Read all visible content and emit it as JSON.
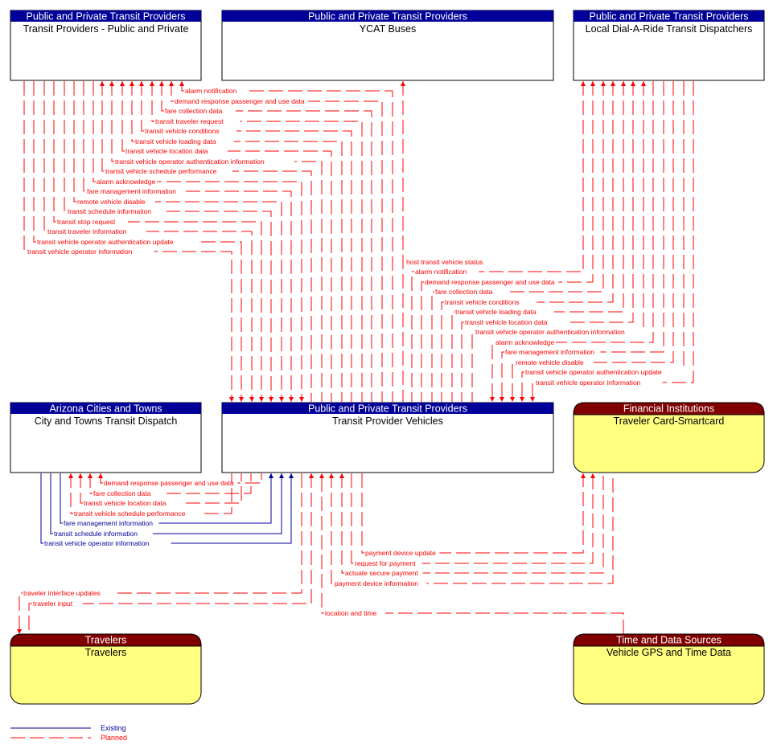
{
  "colors": {
    "planned": "#ff0000",
    "existing": "#000099",
    "node_header_blue": "#000099",
    "node_header_maroon": "#800000",
    "node_fill_yellow": "#ffff80"
  },
  "nodes": {
    "tp": {
      "header": "Public and Private Transit Providers",
      "name": "Transit Providers - Public and Private"
    },
    "ycat": {
      "header": "Public and Private Transit Providers",
      "name": "YCAT Buses"
    },
    "dar": {
      "header": "Public and Private Transit Providers",
      "name": "Local Dial-A-Ride Transit Dispatchers"
    },
    "city": {
      "header": "Arizona Cities and Towns",
      "name": "City and Towns Transit Dispatch"
    },
    "veh": {
      "header": "Public and Private Transit Providers",
      "name": "Transit Provider Vehicles"
    },
    "fin": {
      "header": "Financial Institutions",
      "name": "Traveler Card-Smartcard"
    },
    "trav": {
      "header": "Travelers",
      "name": "Travelers"
    },
    "gps": {
      "header": "Time and Data Sources",
      "name": "Vehicle GPS and Time Data"
    }
  },
  "flows_tp": [
    {
      "label": "alarm notification",
      "dir": "to_tp"
    },
    {
      "label": "demand response passenger and use data",
      "dir": "to_tp"
    },
    {
      "label": "fare collection data",
      "dir": "to_tp"
    },
    {
      "label": "transit traveler request",
      "dir": "to_tp"
    },
    {
      "label": "transit vehicle conditions",
      "dir": "to_tp"
    },
    {
      "label": "transit vehicle loading data",
      "dir": "to_tp"
    },
    {
      "label": "transit vehicle location data",
      "dir": "to_tp"
    },
    {
      "label": "transit vehicle operator authentication information",
      "dir": "to_tp"
    },
    {
      "label": "transit vehicle schedule performance",
      "dir": "to_tp"
    },
    {
      "label": "alarm acknowledge",
      "dir": "to_veh"
    },
    {
      "label": "fare management information",
      "dir": "to_veh"
    },
    {
      "label": "remote vehicle disable",
      "dir": "to_veh"
    },
    {
      "label": "transit schedule information",
      "dir": "to_veh"
    },
    {
      "label": "transit stop request",
      "dir": "to_veh"
    },
    {
      "label": "transit traveler information",
      "dir": "to_veh"
    },
    {
      "label": "transit vehicle operator authentication update",
      "dir": "to_veh"
    },
    {
      "label": "transit vehicle operator information",
      "dir": "to_veh"
    }
  ],
  "flows_ycat": [
    {
      "label": "host transit vehicle status",
      "dir": "to_ycat"
    }
  ],
  "flows_dar": [
    {
      "label": "alarm notification",
      "dir": "to_dar"
    },
    {
      "label": "demand response passenger and use data",
      "dir": "to_dar"
    },
    {
      "label": "fare collection data",
      "dir": "to_dar"
    },
    {
      "label": "transit vehicle conditions",
      "dir": "to_dar"
    },
    {
      "label": "transit vehicle loading data",
      "dir": "to_dar"
    },
    {
      "label": "transit vehicle location data",
      "dir": "to_dar"
    },
    {
      "label": "transit vehicle operator authentication information",
      "dir": "to_dar"
    },
    {
      "label": "alarm acknowledge",
      "dir": "to_veh"
    },
    {
      "label": "fare management information",
      "dir": "to_veh"
    },
    {
      "label": "remote vehicle disable",
      "dir": "to_veh"
    },
    {
      "label": "transit vehicle operator authentication update",
      "dir": "to_veh"
    },
    {
      "label": "transit vehicle operator information",
      "dir": "to_veh"
    }
  ],
  "flows_city": [
    {
      "label": "demand response passenger and use data",
      "dir": "to_city",
      "status": "planned"
    },
    {
      "label": "fare collection data",
      "dir": "to_city",
      "status": "planned"
    },
    {
      "label": "transit vehicle location data",
      "dir": "to_city",
      "status": "planned"
    },
    {
      "label": "transit vehicle schedule performance",
      "dir": "to_city",
      "status": "planned"
    },
    {
      "label": "fare management information",
      "dir": "to_veh",
      "status": "existing"
    },
    {
      "label": "transit schedule information",
      "dir": "to_veh",
      "status": "existing"
    },
    {
      "label": "transit vehicle operator information",
      "dir": "to_veh",
      "status": "existing"
    }
  ],
  "flows_fin": [
    {
      "label": "payment device update",
      "dir": "to_fin"
    },
    {
      "label": "request for payment",
      "dir": "to_fin"
    },
    {
      "label": "actuate secure payment",
      "dir": "to_veh"
    },
    {
      "label": "payment device information",
      "dir": "to_veh"
    }
  ],
  "flows_trav": [
    {
      "label": "traveler interface updates",
      "dir": "to_trav"
    },
    {
      "label": "traveler input",
      "dir": "to_veh"
    }
  ],
  "flows_gps": [
    {
      "label": "location and time",
      "dir": "to_veh"
    }
  ],
  "legend": {
    "existing": "Existing",
    "planned": "Planned"
  }
}
